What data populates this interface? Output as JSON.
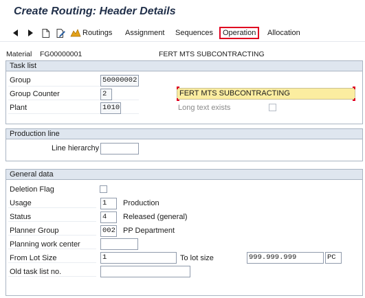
{
  "window": {
    "title": "Create Routing: Header Details"
  },
  "toolbar": {
    "icons": [
      "back-arrow-icon",
      "forward-arrow-icon",
      "new-document-icon",
      "edit-document-icon",
      "routings-icon"
    ],
    "routings_label": "Routings",
    "assignment_label": "Assignment",
    "sequences_label": "Sequences",
    "operation_label": "Operation",
    "allocation_label": "Allocation"
  },
  "material": {
    "label": "Material",
    "value": "FG00000001",
    "description": "FERT MTS SUBCONTRACTING"
  },
  "task_list": {
    "header": "Task list",
    "group_label": "Group",
    "group_value": "50000002",
    "group_counter_label": "Group Counter",
    "group_counter_value": "2",
    "plant_label": "Plant",
    "plant_value": "1010",
    "description_value": "FERT MTS SUBCONTRACTING",
    "long_text_label": "Long text exists",
    "long_text_checked": false
  },
  "production_line": {
    "header": "Production line",
    "line_hierarchy_label": "Line hierarchy",
    "line_hierarchy_value": ""
  },
  "general_data": {
    "header": "General data",
    "deletion_flag_label": "Deletion Flag",
    "deletion_flag_checked": false,
    "usage_label": "Usage",
    "usage_value": "1",
    "usage_text": "Production",
    "status_label": "Status",
    "status_value": "4",
    "status_text": "Released (general)",
    "planner_group_label": "Planner Group",
    "planner_group_value": "002",
    "planner_group_text": "PP Department",
    "planning_wc_label": "Planning work center",
    "planning_wc_value": "",
    "from_lot_label": "From Lot Size",
    "from_lot_value": "1",
    "to_lot_label": "To lot size",
    "to_lot_value": "999.999.999",
    "unit_value": "PC",
    "old_task_list_label": "Old task list no.",
    "old_task_list_value": ""
  },
  "colors": {
    "highlight_border": "#e00020",
    "group_header_bg": "#dfe6ef",
    "yellow_field": "#fbeda0"
  }
}
